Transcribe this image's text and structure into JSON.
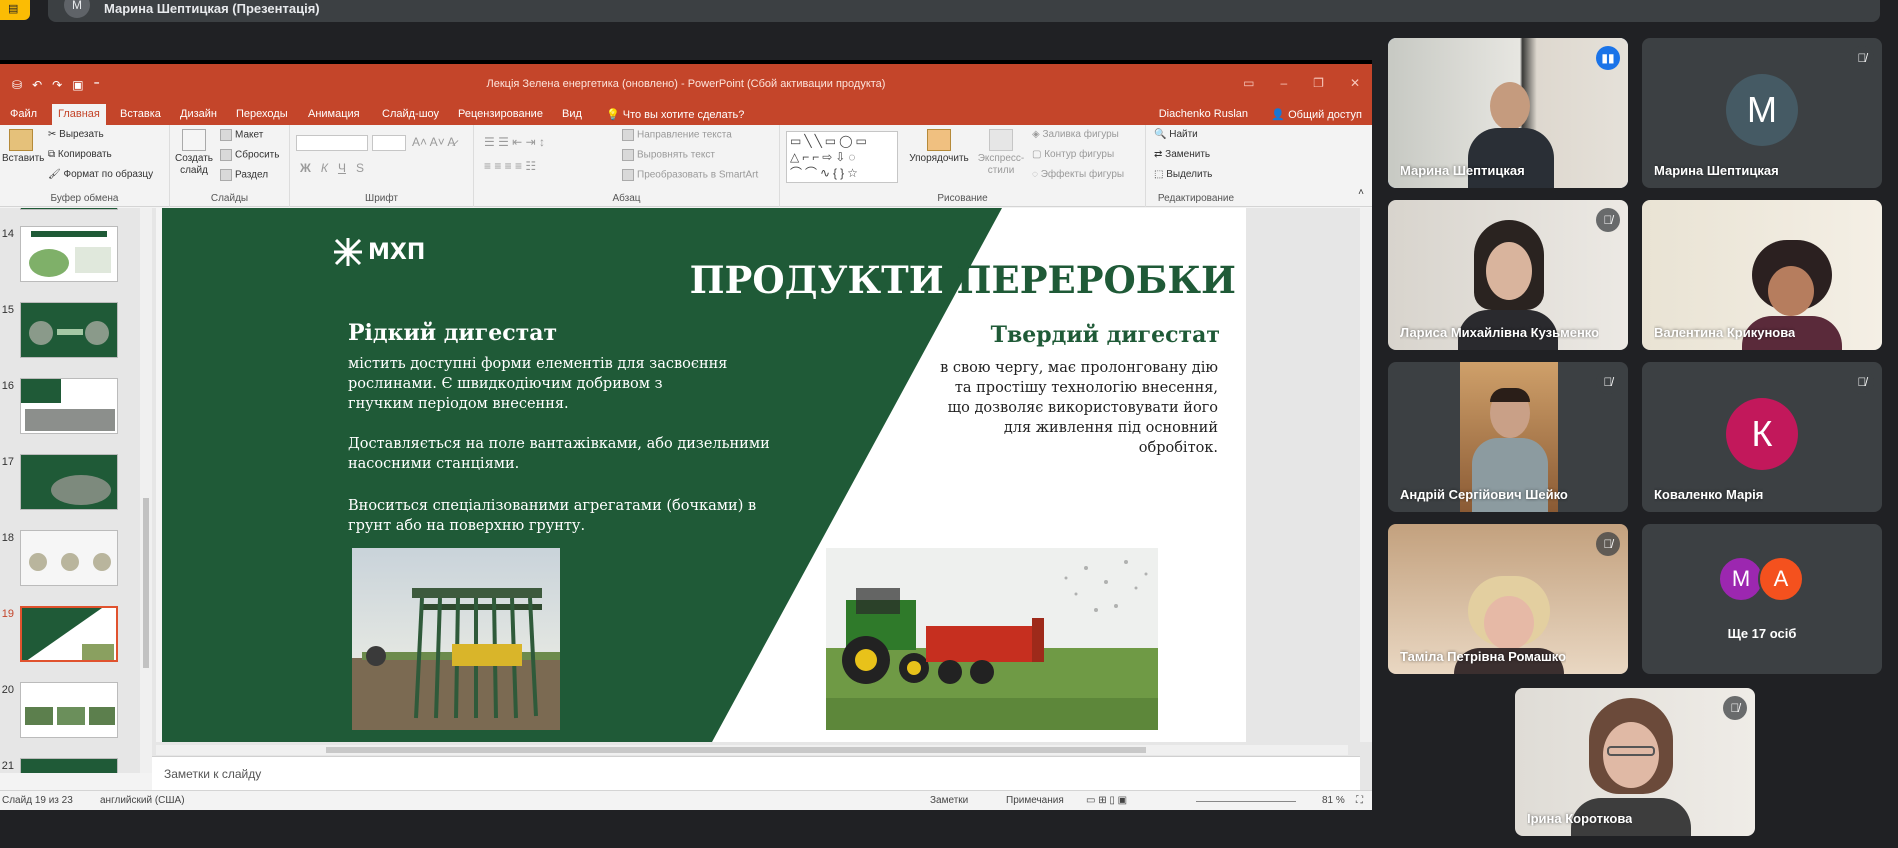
{
  "meet": {
    "presenter_title": "Марина Шептицкая (Презентація)",
    "presenter_initial": "М"
  },
  "ppt": {
    "window_title": "Лекція Зелена енергетика (оновлено) - PowerPoint (Сбой активации продукта)",
    "user": "Diachenko Ruslan",
    "share": "Общий доступ",
    "tabs": [
      "Файл",
      "Главная",
      "Вставка",
      "Дизайн",
      "Переходы",
      "Анимация",
      "Слайд-шоу",
      "Рецензирование",
      "Вид",
      "Что вы хотите сделать?"
    ],
    "ribbon": {
      "clipboard": {
        "paste": "Вставить",
        "cut": "Вырезать",
        "copy": "Копировать",
        "format": "Формат по образцу",
        "label": "Буфер обмена"
      },
      "slides": {
        "new": "Создать слайд",
        "layout": "Макет",
        "reset": "Сбросить",
        "section": "Раздел",
        "label": "Слайды"
      },
      "font": {
        "bold": "Ж",
        "italic": "К",
        "underline": "Ч",
        "strike": "S",
        "label": "Шрифт"
      },
      "paragraph": {
        "dir": "Направление текста",
        "align": "Выровнять текст",
        "smartart": "Преобразовать в SmartArt",
        "label": "Абзац"
      },
      "drawing": {
        "arrange": "Упорядочить",
        "styles": "Экспресс-стили",
        "fill": "Заливка фигуры",
        "outline": "Контур фигуры",
        "effects": "Эффекты фигуры",
        "label": "Рисование"
      },
      "editing": {
        "find": "Найти",
        "replace": "Заменить",
        "select": "Выделить",
        "label": "Редактирование"
      }
    },
    "thumbs": [
      {
        "num": "14"
      },
      {
        "num": "15"
      },
      {
        "num": "16"
      },
      {
        "num": "17"
      },
      {
        "num": "18"
      },
      {
        "num": "19"
      },
      {
        "num": "20"
      },
      {
        "num": "21"
      }
    ],
    "notes": "Заметки к слайду",
    "status": {
      "slide": "Слайд 19 из 23",
      "lang": "английский (США)",
      "notes": "Заметки",
      "comments": "Примечания",
      "zoom": "81 %"
    }
  },
  "slide": {
    "logo": "МХП",
    "title_left": "ПРОДУКТИ ",
    "title_right": "ПЕРЕРОБКИ",
    "left_heading": "Рідкий дигестат",
    "left_p1_l1": "містить доступні форми елементів для засвоєння",
    "left_p1_l2": "рослинами. Є швидкодіючим добривом з",
    "left_p1_l3": "гнучким періодом внесення.",
    "left_p2_l1": "Доставляється на поле вантажівками, або дизельними",
    "left_p2_l2": "насосними станціями.",
    "left_p3_l1": "Вноситься спеціалізованими агрегатами (бочками) в",
    "left_p3_l2": "грунт або на поверхню грунту.",
    "right_heading": "Твердий дигестат",
    "right_p_l1": "в свою чергу, має пролонговану дію",
    "right_p_l2": "та простішу технологію внесення,",
    "right_p_l3": "що дозволяє використовувати його",
    "right_p_l4": "для живлення під основний",
    "right_p_l5": "обробіток."
  },
  "participants": [
    {
      "name": "Марина Шептицкая",
      "video": true,
      "speaking": true
    },
    {
      "name": "Марина Шептицкая",
      "initial": "М",
      "color": "#455a64"
    },
    {
      "name": "Лариса Михайлівна Кузьменко",
      "video": true
    },
    {
      "name": "Валентина Крикунова",
      "video": true
    },
    {
      "name": "Андрій Сергійович Шейко",
      "video": true
    },
    {
      "name": "Коваленко Марія",
      "initial": "К",
      "color": "#c2185b"
    },
    {
      "name": "Таміла Петрівна Ромашко",
      "video": true
    },
    {
      "name": "Ще 17 осіб",
      "initials": [
        "М",
        "А"
      ],
      "colors": [
        "#9c27b0",
        "#f4511e"
      ]
    },
    {
      "name": "Ірина Короткова",
      "video": true
    }
  ],
  "colors": {
    "ppt_accent": "#c4452a",
    "slide_green": "#1f5a37",
    "meet_bg": "#202124",
    "tile_bg": "#3c4043",
    "speaking": "#8ab4f8"
  }
}
